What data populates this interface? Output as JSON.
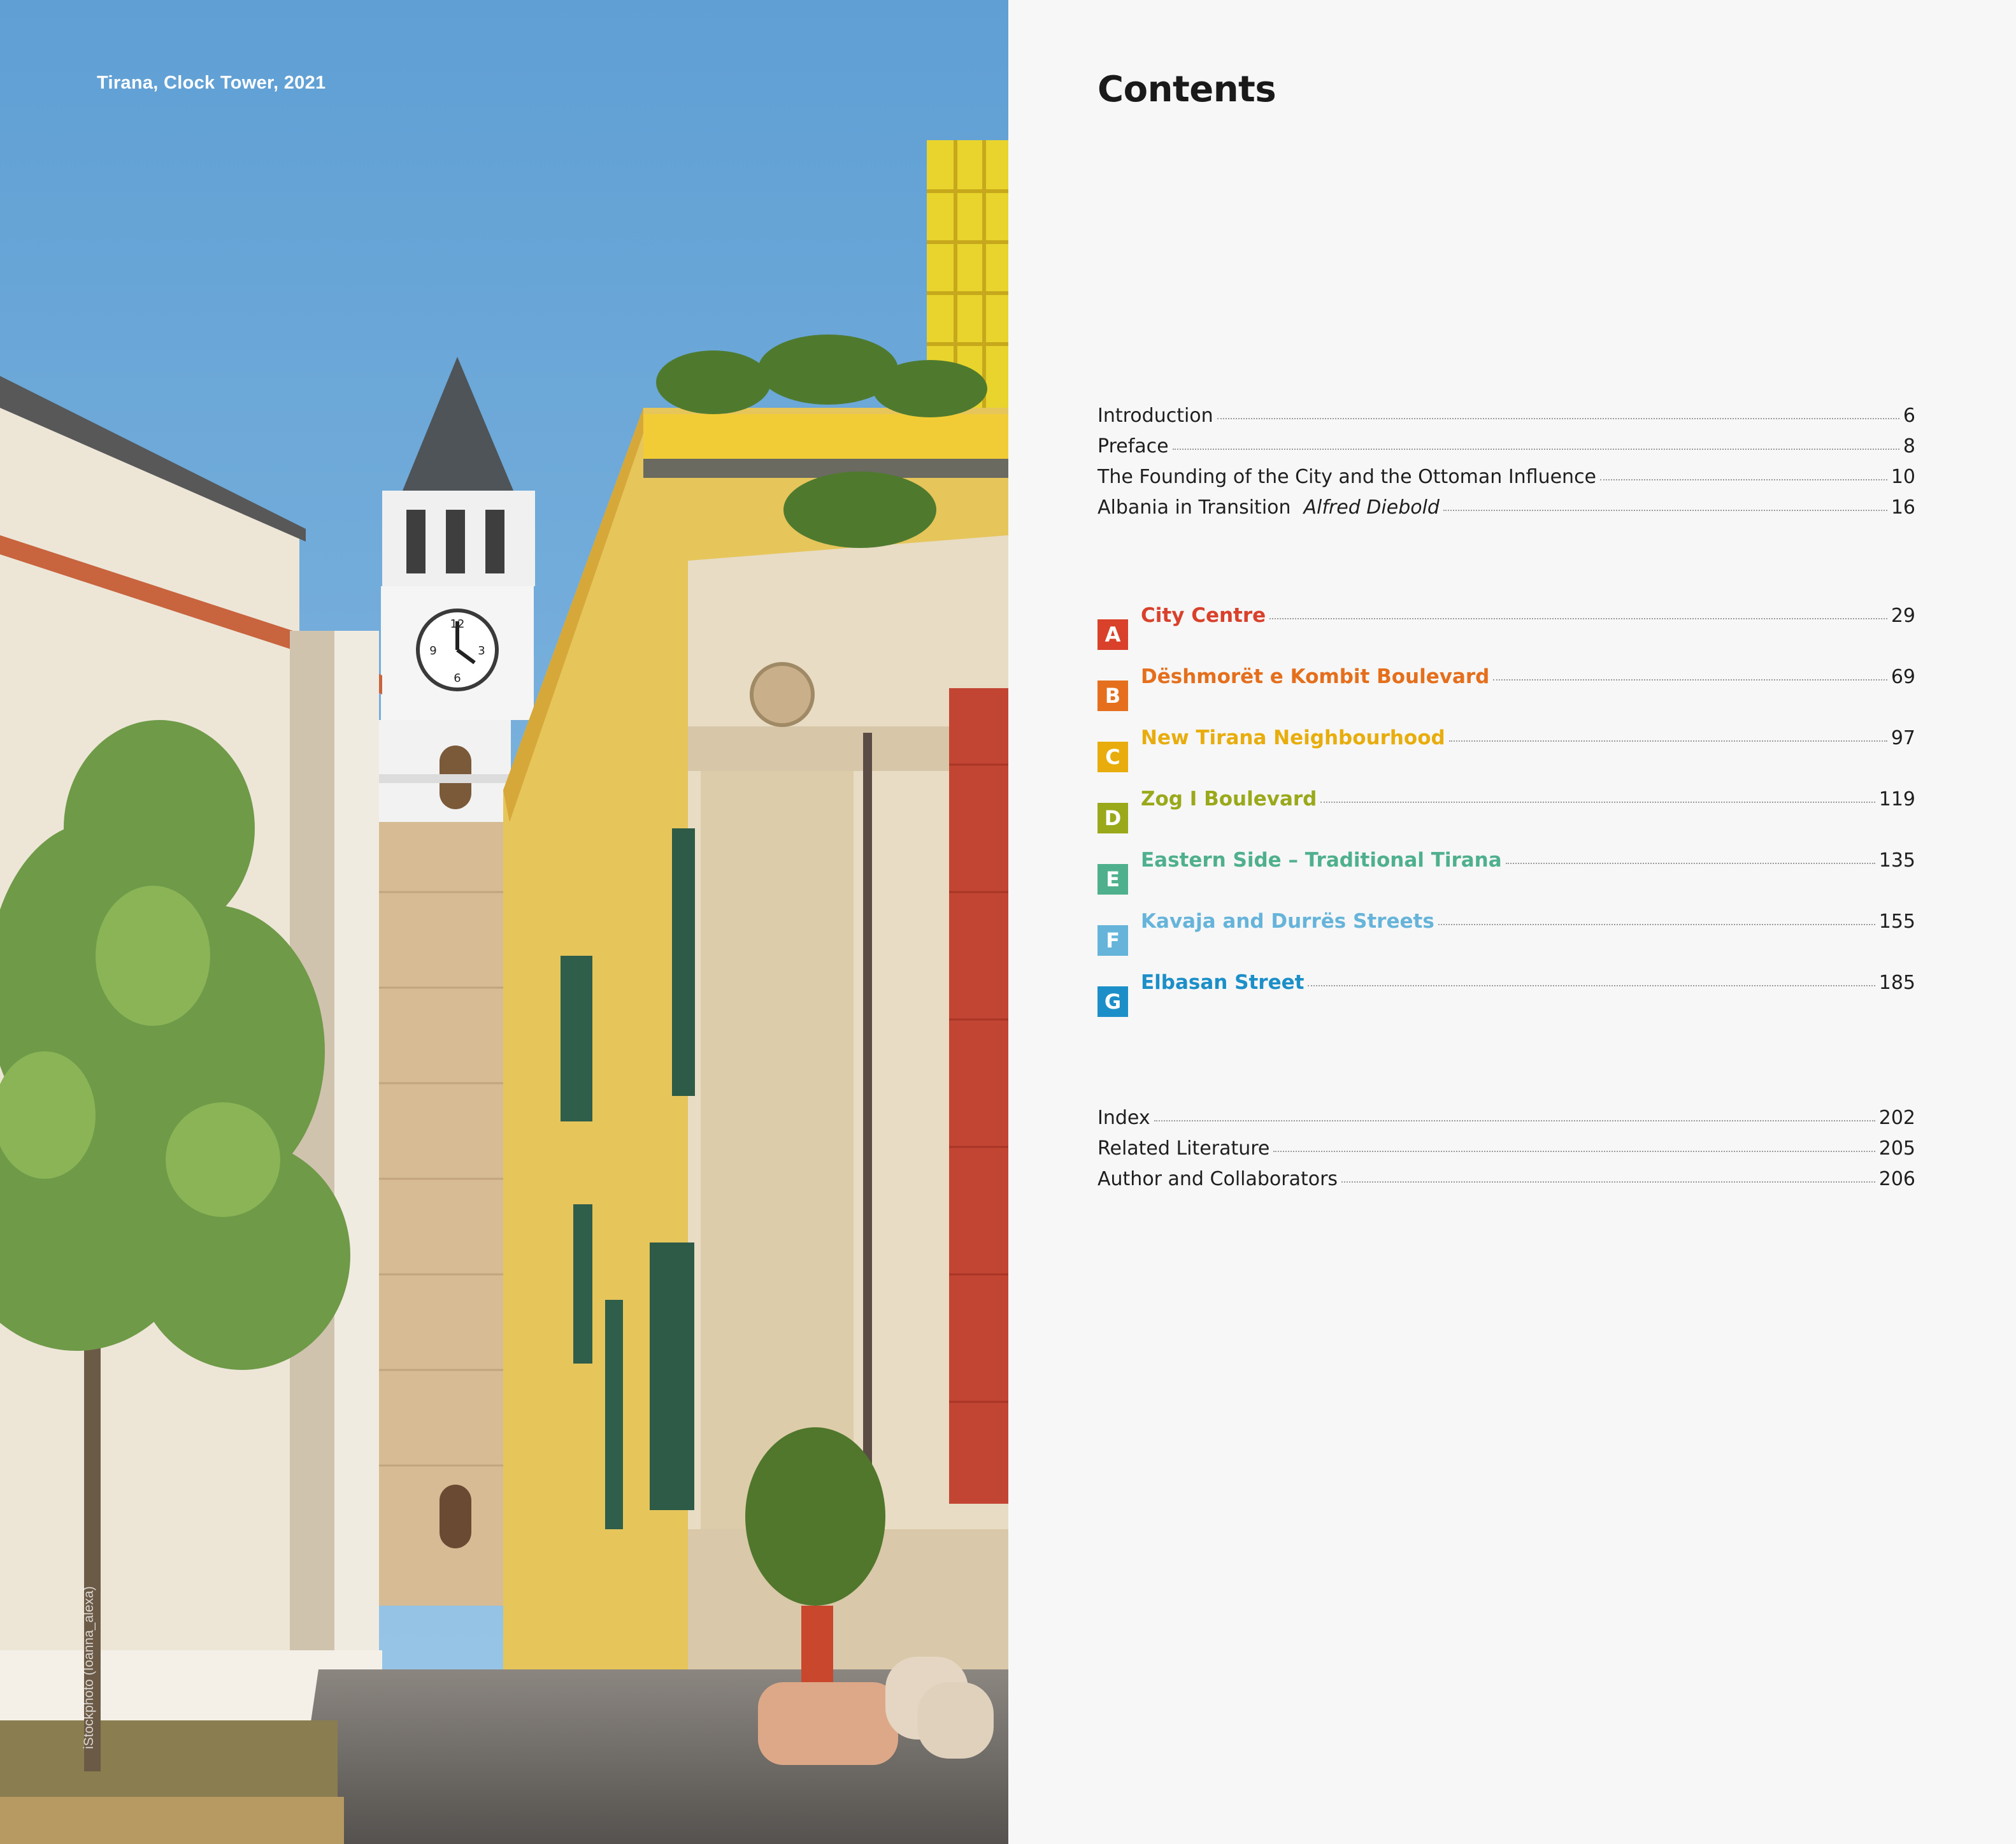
{
  "photo": {
    "caption": "Tirana, Clock Tower, 2021",
    "credit": "iStockphoto (Ioanna_alexa)",
    "clock_numbers": [
      "12",
      "3",
      "6",
      "9"
    ]
  },
  "contents": {
    "title": "Contents",
    "front_matter": [
      {
        "label": "Introduction",
        "author": "",
        "page": "6"
      },
      {
        "label": "Preface",
        "author": "",
        "page": "8"
      },
      {
        "label": "The Founding of the City and the Ottoman Influence",
        "author": "",
        "page": "10"
      },
      {
        "label": "Albania in Transition",
        "author": "Alfred Diebold",
        "page": "16"
      }
    ],
    "chapters": [
      {
        "letter": "A",
        "label": "City Centre",
        "page": "29",
        "color": "#d9412b"
      },
      {
        "letter": "B",
        "label": "Dëshmorët e Kombit Boulevard",
        "page": "69",
        "color": "#e56f1c"
      },
      {
        "letter": "C",
        "label": "New Tirana Neighbourhood",
        "page": "97",
        "color": "#e8ad0d"
      },
      {
        "letter": "D",
        "label": "Zog I Boulevard",
        "page": "119",
        "color": "#9aa91a"
      },
      {
        "letter": "E",
        "label": "Eastern Side – Traditional Tirana",
        "page": "135",
        "color": "#4fb08d"
      },
      {
        "letter": "F",
        "label": "Kavaja and Durrës Streets",
        "page": "155",
        "color": "#66b4da"
      },
      {
        "letter": "G",
        "label": "Elbasan Street",
        "page": "185",
        "color": "#1c8fc8"
      }
    ],
    "back_matter": [
      {
        "label": "Index",
        "page": "202"
      },
      {
        "label": "Related Literature",
        "page": "205"
      },
      {
        "label": "Author and Collaborators",
        "page": "206"
      }
    ]
  }
}
